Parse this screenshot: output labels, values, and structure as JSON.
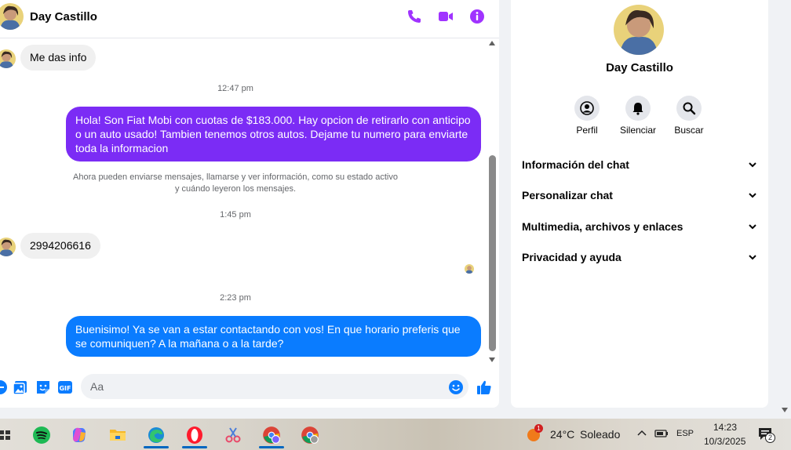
{
  "header": {
    "name": "Day Castillo"
  },
  "messages": {
    "in1": "Me das info",
    "ts1": "12:47 pm",
    "out1": "Hola! Son Fiat Mobi con cuotas de $183.000. Hay opcion de retirarlo con anticipo o un auto usado! Tambien tenemos otros autos. Dejame tu numero para enviarte toda la informacion",
    "sys_line1": "Ahora pueden enviarse mensajes, llamarse y ver información, como su estado activo",
    "sys_line2": "y cuándo leyeron los mensajes.",
    "ts2": "1:45 pm",
    "in2": "2994206616",
    "ts3": "2:23 pm",
    "out2": "Buenisimo! Ya se van a estar contactando con vos! En que horario preferis que se comuniquen? A la mañana o a la tarde?"
  },
  "composer": {
    "placeholder": "Aa"
  },
  "info": {
    "name": "Day Castillo",
    "actions": [
      {
        "label": "Perfil",
        "icon": "profile-icon"
      },
      {
        "label": "Silenciar",
        "icon": "bell-icon"
      },
      {
        "label": "Buscar",
        "icon": "search-icon"
      }
    ],
    "sections": [
      "Información del chat",
      "Personalizar chat",
      "Multimedia, archivos y enlaces",
      "Privacidad y ayuda"
    ]
  },
  "taskbar": {
    "weather_temp": "24°C",
    "weather_desc": "Soleado",
    "weather_badge": "1",
    "lang": "ESP",
    "time": "14:23",
    "date": "10/3/2025",
    "notif_count": "2"
  },
  "colors": {
    "messenger_purple": "#a033ff",
    "out_bubble_purple": "#7b2cf5",
    "out_bubble_blue": "#0a7cff",
    "composer_blue": "#0a7cff"
  }
}
